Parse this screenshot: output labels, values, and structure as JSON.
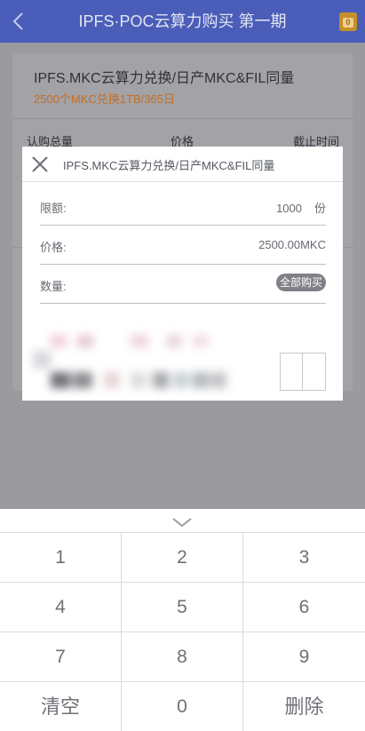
{
  "header": {
    "title": "IPFS·POC云算力购买 第一期",
    "wallet_icon_text": "0"
  },
  "background": {
    "product_title": "IPFS.MKC云算力兑换/日产MKC&FIL同量",
    "product_subtitle": "2500个MKC兑换1TB/365日",
    "columns": [
      "认购总量",
      "价格",
      "截止时间"
    ]
  },
  "modal": {
    "title": "IPFS.MKC云算力兑换/日产MKC&FIL同量",
    "limit_label": "限额:",
    "limit_value": "1000",
    "limit_unit": "份",
    "price_label": "价格:",
    "price_value": "2500.00MKC",
    "quantity_label": "数量:",
    "buy_all_label": "全部购买"
  },
  "keypad": {
    "keys": [
      "1",
      "2",
      "3",
      "4",
      "5",
      "6",
      "7",
      "8",
      "9",
      "清空",
      "0",
      "删除"
    ]
  },
  "colors": {
    "header_bg": "#4a5db8",
    "accent_orange": "#c66f20",
    "overlay": "#9a9a9f"
  }
}
